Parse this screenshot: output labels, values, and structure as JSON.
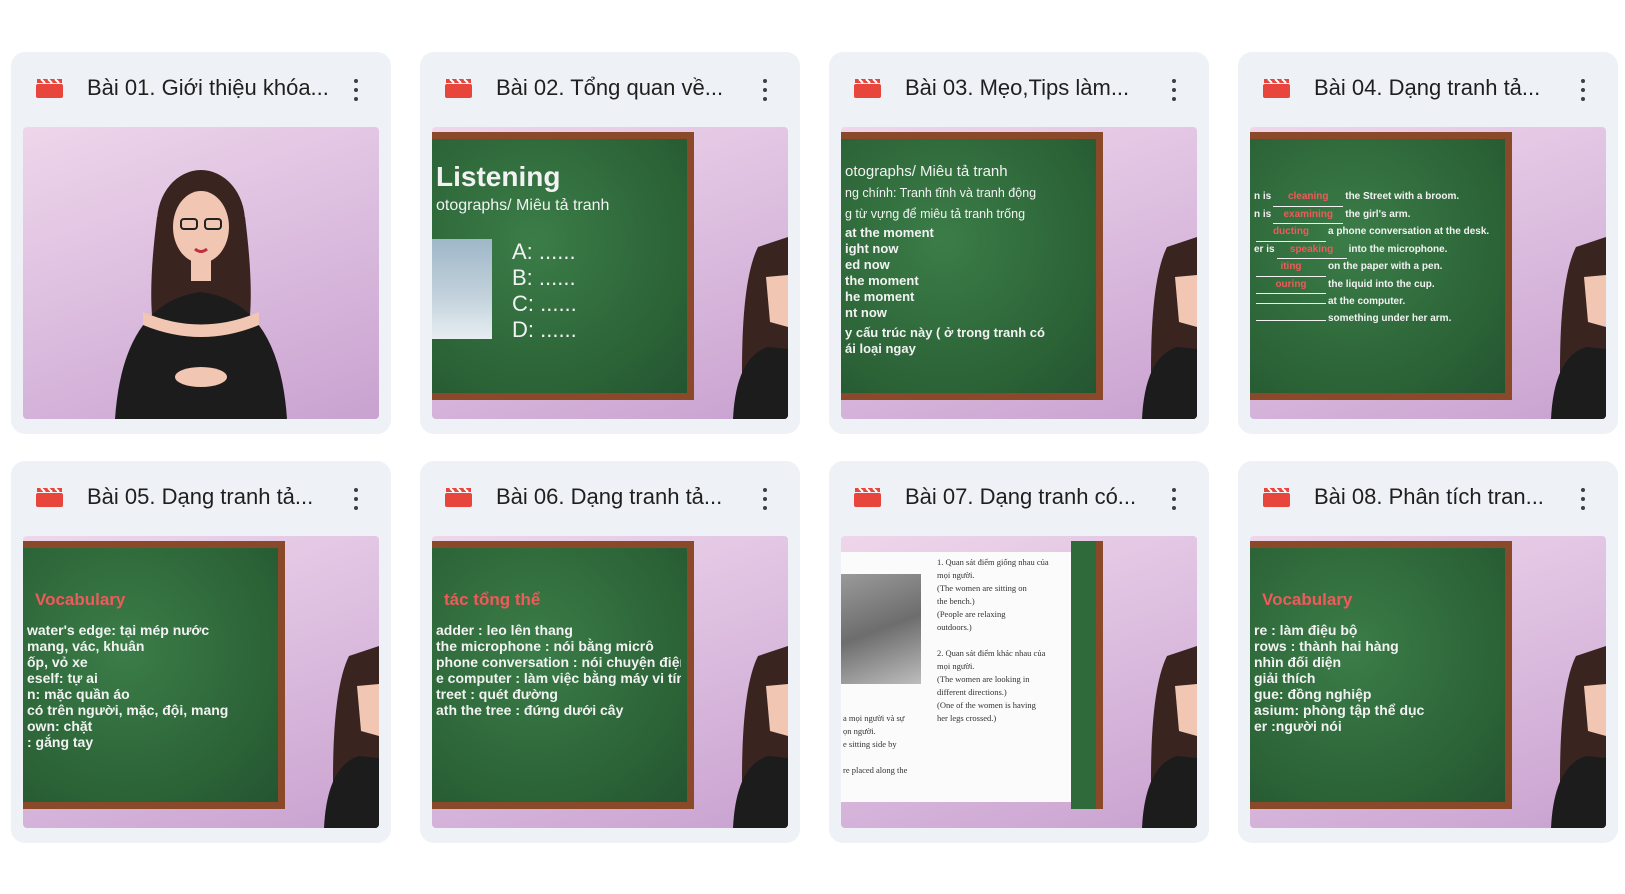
{
  "lessons": [
    {
      "title": "Bài 01. Giới thiệu khóa...",
      "thumb": {
        "kind": "teacher",
        "lines": []
      }
    },
    {
      "title": "Bài 02. Tổng quan về...",
      "thumb": {
        "kind": "board-listening",
        "heading": "Listening",
        "subheading": "otographs/ Miêu tả tranh",
        "options": [
          "A: ......",
          "B: ......",
          "C: ......",
          "D: ......"
        ]
      }
    },
    {
      "title": "Bài 03. Mẹo,Tips làm...",
      "thumb": {
        "kind": "board",
        "lines": [
          "otographs/ Miêu tả tranh",
          "ng chính: Tranh tĩnh và tranh động",
          "g từ vựng để miêu tả tranh trống",
          "at the moment",
          "ight now",
          "ed now",
          " the moment",
          "he moment",
          "nt now",
          "y cấu trúc này ( ở trong tranh có",
          "ái loại ngay"
        ]
      }
    },
    {
      "title": "Bài 04. Dạng tranh tả...",
      "thumb": {
        "kind": "board-fill",
        "lines": [
          {
            "pre": "n is",
            "fill": "cleaning",
            "post": "the Street with a broom."
          },
          {
            "pre": "n is",
            "fill": "examining",
            "post": "the girl's arm."
          },
          {
            "pre": "",
            "fill": "ducting",
            "post": "a phone conversation at the desk."
          },
          {
            "pre": "er is",
            "fill": "speaking",
            "post": "into the microphone."
          },
          {
            "pre": "",
            "fill": "iting",
            "post": "on the paper with a pen."
          },
          {
            "pre": "",
            "fill": "ouring",
            "post": "the liquid into the cup."
          },
          {
            "pre": "",
            "fill": "",
            "post": "at the computer."
          },
          {
            "pre": "",
            "fill": "",
            "post": "something under her arm."
          }
        ]
      }
    },
    {
      "title": "Bài 05. Dạng tranh tả...",
      "thumb": {
        "kind": "board-vocab",
        "heading": "Vocabulary",
        "lines": [
          " water's edge: tại mép nước",
          " mang, vác, khuân",
          "ốp, vỏ xe",
          "eself: tự ai",
          "n: mặc quần áo",
          " có trên người, mặc, đội, mang",
          "own: chặt",
          ": gắng tay"
        ]
      }
    },
    {
      "title": "Bài 06. Dạng tranh tả...",
      "thumb": {
        "kind": "board-vocab",
        "heading": "tác tổng thể",
        "lines": [
          "adder : leo lên thang",
          "the microphone : nói bằng micrô",
          "phone conversation : nói chuyện điện",
          "",
          "e computer : làm việc bằng máy vi tính",
          "treet : quét đường",
          "ath the tree : đứng dưới cây"
        ]
      }
    },
    {
      "title": "Bài 07. Dạng tranh có...",
      "thumb": {
        "kind": "paper",
        "right_lines": [
          "1. Quan sát điểm giống nhau của",
          "mọi người.",
          "(The women are sitting on",
          "the bench.)",
          "(People are relaxing",
          "outdoors.)",
          "",
          "2. Quan sát điểm khác nhau của",
          "mọi người.",
          "(The women are looking in",
          "different directions.)",
          "(One of the women is having",
          "her legs crossed.)"
        ],
        "left_lines": [
          "a mọi người và sự",
          "ọn người.",
          "e sitting side by",
          "",
          "re placed along the"
        ]
      }
    },
    {
      "title": "Bài 08. Phân tích tran...",
      "thumb": {
        "kind": "board-vocab",
        "heading": "Vocabulary",
        "lines": [
          "re : làm điệu bộ",
          " rows : thành hai hàng",
          "nhìn đối diện",
          " giải thích",
          "gue: đồng nghiệp",
          "asium: phòng tập thể dục",
          "er :người nói"
        ]
      }
    }
  ],
  "colors": {
    "card_bg": "#eef1f5",
    "icon_red": "#e8453c",
    "board_green": "#2e6a3a",
    "board_frame": "#8a4a2a",
    "fill_red": "#ef5a5a"
  },
  "icons": {
    "lesson": "video-clapper-icon",
    "menu": "more-vert-icon"
  }
}
